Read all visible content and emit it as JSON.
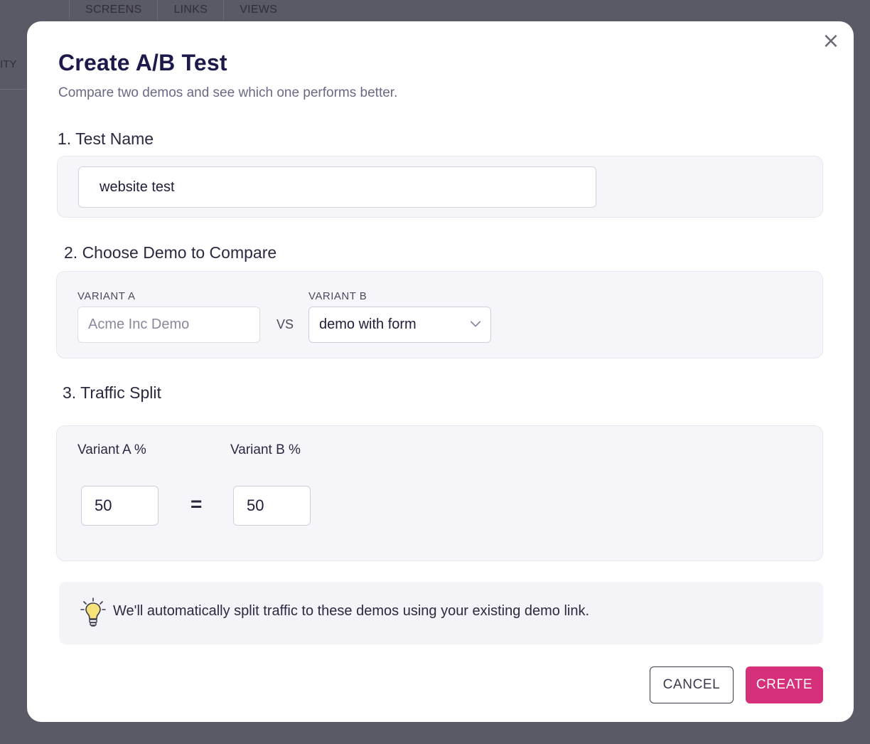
{
  "background": {
    "tabs": [
      "SCREENS",
      "LINKS",
      "VIEWS"
    ],
    "side_label": "ITY"
  },
  "modal": {
    "title": "Create A/B Test",
    "subtitle": "Compare two demos and see which one performs better.",
    "close_icon": "close-icon",
    "step1": {
      "label": "1. Test Name",
      "value": "website test"
    },
    "step2": {
      "label": "2. Choose Demo to Compare",
      "variant_a_label": "VARIANT A",
      "variant_a_value": "Acme Inc Demo",
      "vs": "VS",
      "variant_b_label": "VARIANT B",
      "variant_b_value": "demo with form"
    },
    "step3": {
      "label": "3. Traffic Split",
      "variant_a_pct_label": "Variant A %",
      "variant_b_pct_label": "Variant B %",
      "variant_a_pct": "50",
      "equals": "=",
      "variant_b_pct": "50"
    },
    "tip": {
      "icon": "lightbulb-icon",
      "text": "We'll automatically split traffic to these demos using your existing demo link."
    },
    "buttons": {
      "cancel": "CANCEL",
      "create": "CREATE"
    }
  },
  "colors": {
    "accent": "#d6307a",
    "title": "#1c1a4a",
    "overlay": "#54535f"
  }
}
